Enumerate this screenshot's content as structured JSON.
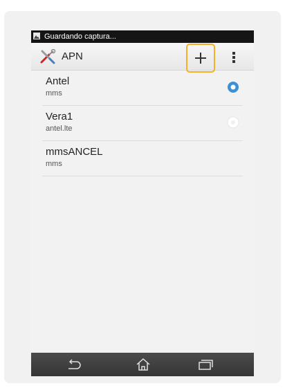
{
  "status_bar": {
    "text": "Guardando captura...",
    "icon": "image-icon"
  },
  "action_bar": {
    "title": "APN",
    "app_icon": "tools-icon",
    "add_icon": "plus-icon",
    "menu_icon": "overflow-menu-icon",
    "highlight_color": "#f3b127"
  },
  "apn_list": [
    {
      "name": "Antel",
      "apn": "mms",
      "selected": true
    },
    {
      "name": "Vera1",
      "apn": "antel.lte",
      "selected": false
    },
    {
      "name": "mmsANCEL",
      "apn": "mms",
      "selected": null
    }
  ],
  "nav_bar": {
    "back_icon": "back-icon",
    "home_icon": "home-icon",
    "recents_icon": "recents-icon"
  },
  "colors": {
    "radio_selected": "#3d8fd6",
    "status_bar": "#151515",
    "nav_bar": "#404040"
  }
}
